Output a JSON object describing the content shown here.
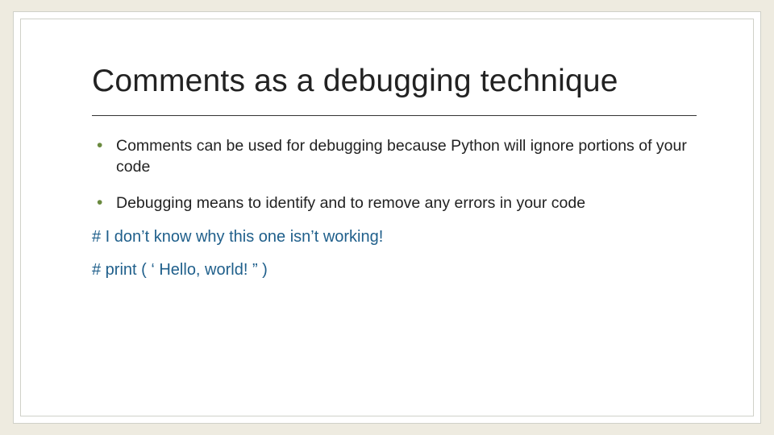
{
  "title": "Comments as a debugging technique",
  "bullets": [
    "Comments can be used for debugging because Python will ignore portions of your code",
    "Debugging means to identify and to remove any errors in your code"
  ],
  "code_lines": [
    "# I don’t know why this one isn’t working!",
    "# print ( ‘ Hello, world! ” )"
  ]
}
